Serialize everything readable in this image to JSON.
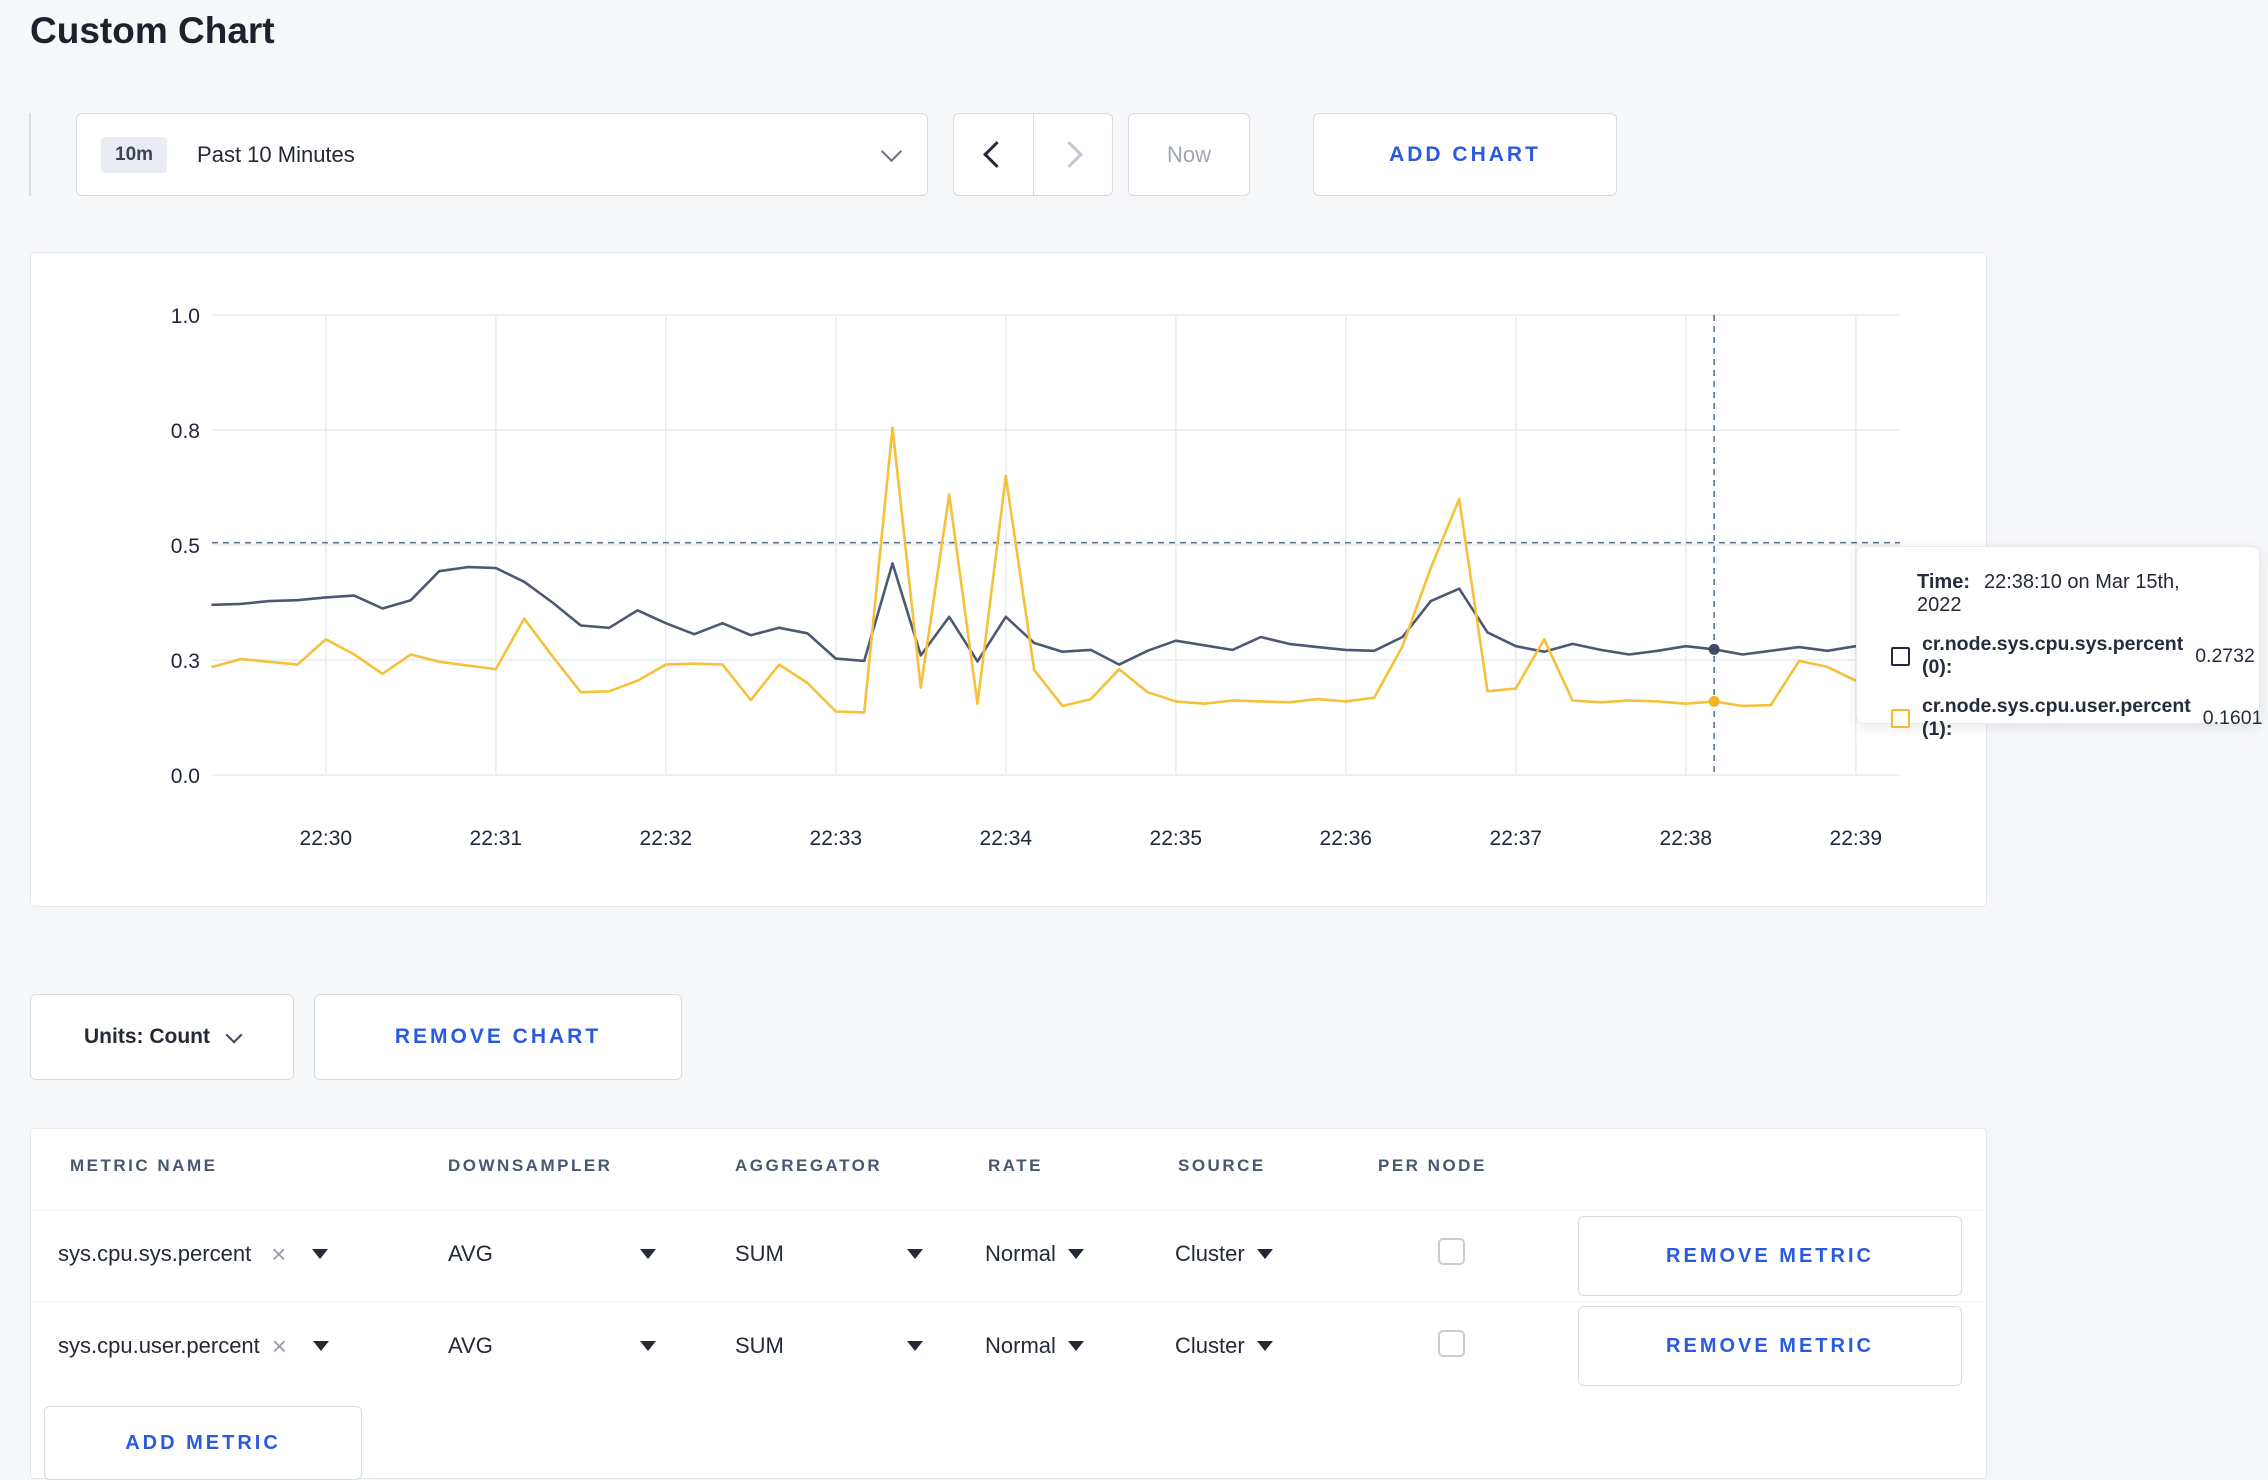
{
  "page": {
    "title": "Custom Chart"
  },
  "toolbar": {
    "range_badge": "10m",
    "range_label": "Past 10 Minutes",
    "now_label": "Now",
    "add_chart_label": "ADD CHART"
  },
  "chart_controls": {
    "units_label": "Units: Count",
    "remove_chart_label": "REMOVE CHART"
  },
  "icons": {
    "clear": "×"
  },
  "tooltip": {
    "time_label": "Time:",
    "time_value": "22:38:10 on Mar 15th, 2022",
    "rows": [
      {
        "name": "cr.node.sys.cpu.sys.percent (0):",
        "value": "0.2732",
        "color": "#21283f"
      },
      {
        "name": "cr.node.sys.cpu.user.percent (1):",
        "value": "0.1601",
        "color": "#f2bd2d"
      }
    ]
  },
  "metric_table": {
    "headers": [
      "METRIC NAME",
      "DOWNSAMPLER",
      "AGGREGATOR",
      "RATE",
      "SOURCE",
      "PER NODE"
    ],
    "rows": [
      {
        "metric": "sys.cpu.sys.percent",
        "downsampler": "AVG",
        "aggregator": "SUM",
        "rate": "Normal",
        "source": "Cluster",
        "per_node_checked": false,
        "remove_label": "REMOVE METRIC"
      },
      {
        "metric": "sys.cpu.user.percent",
        "downsampler": "AVG",
        "aggregator": "SUM",
        "rate": "Normal",
        "source": "Cluster",
        "per_node_checked": false,
        "remove_label": "REMOVE METRIC"
      }
    ],
    "add_metric_label": "ADD METRIC"
  },
  "chart_data": {
    "type": "line",
    "x_start_time": "22:29:20",
    "x_interval_seconds": 10,
    "x_ticks": [
      "22:30",
      "22:31",
      "22:32",
      "22:33",
      "22:34",
      "22:35",
      "22:36",
      "22:37",
      "22:38",
      "22:39"
    ],
    "y_ticks": [
      {
        "v": 0.0,
        "label": "0.0"
      },
      {
        "v": 0.25,
        "label": "0.3"
      },
      {
        "v": 0.5,
        "label": "0.5"
      },
      {
        "v": 0.75,
        "label": "0.8"
      },
      {
        "v": 1.0,
        "label": "1.0"
      }
    ],
    "ylim": [
      0,
      1
    ],
    "grid": true,
    "series": [
      {
        "name": "cr.node.sys.cpu.sys.percent",
        "color": "#4d5873",
        "dot_color": "#414b66",
        "values": [
          0.37,
          0.372,
          0.378,
          0.38,
          0.386,
          0.39,
          0.362,
          0.38,
          0.443,
          0.452,
          0.45,
          0.42,
          0.375,
          0.325,
          0.32,
          0.358,
          0.33,
          0.306,
          0.33,
          0.304,
          0.32,
          0.308,
          0.253,
          0.248,
          0.46,
          0.26,
          0.344,
          0.247,
          0.344,
          0.287,
          0.268,
          0.272,
          0.24,
          0.27,
          0.292,
          0.282,
          0.272,
          0.3,
          0.285,
          0.278,
          0.272,
          0.27,
          0.3,
          0.378,
          0.405,
          0.31,
          0.28,
          0.268,
          0.285,
          0.272,
          0.262,
          0.27,
          0.28,
          0.2732,
          0.262,
          0.27,
          0.278,
          0.27,
          0.28,
          0.272
        ]
      },
      {
        "name": "cr.node.sys.cpu.user.percent",
        "color": "#f6c13a",
        "dot_color": "#f2b52a",
        "values": [
          0.235,
          0.252,
          0.246,
          0.24,
          0.295,
          0.262,
          0.22,
          0.262,
          0.246,
          0.238,
          0.23,
          0.34,
          0.258,
          0.18,
          0.182,
          0.205,
          0.24,
          0.242,
          0.24,
          0.163,
          0.24,
          0.2,
          0.138,
          0.136,
          0.755,
          0.19,
          0.61,
          0.155,
          0.65,
          0.228,
          0.15,
          0.165,
          0.23,
          0.18,
          0.16,
          0.155,
          0.162,
          0.16,
          0.158,
          0.165,
          0.16,
          0.168,
          0.28,
          0.45,
          0.6,
          0.182,
          0.188,
          0.295,
          0.162,
          0.158,
          0.162,
          0.16,
          0.155,
          0.1601,
          0.15,
          0.152,
          0.248,
          0.235,
          0.205,
          0.268
        ]
      }
    ],
    "crosshair": {
      "x_index": 53,
      "time": "22:38:10",
      "hline_value": 0.505
    },
    "legend_position": "tooltip-only"
  }
}
